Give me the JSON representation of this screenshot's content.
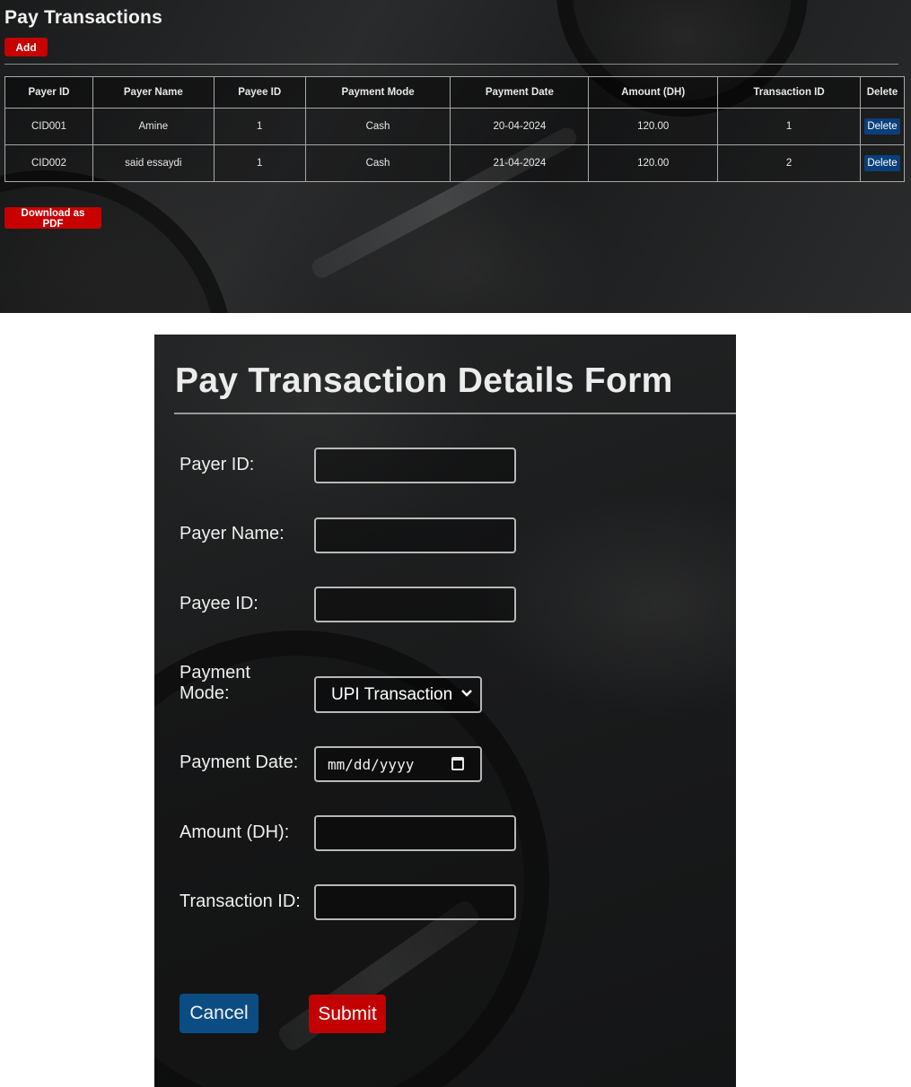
{
  "transactions_page": {
    "title": "Pay Transactions",
    "add_label": "Add",
    "download_label": "Download as PDF",
    "columns": [
      "Payer ID",
      "Payer Name",
      "Payee ID",
      "Payment Mode",
      "Payment Date",
      "Amount (DH)",
      "Transaction ID",
      "Delete"
    ],
    "rows": [
      {
        "payer_id": "CID001",
        "payer_name": "Amine",
        "payee_id": "1",
        "payment_mode": "Cash",
        "payment_date": "20-04-2024",
        "amount": "120.00",
        "transaction_id": "1",
        "delete_label": "Delete"
      },
      {
        "payer_id": "CID002",
        "payer_name": "said essaydi",
        "payee_id": "1",
        "payment_mode": "Cash",
        "payment_date": "21-04-2024",
        "amount": "120.00",
        "transaction_id": "2",
        "delete_label": "Delete"
      }
    ]
  },
  "form": {
    "title": "Pay Transaction Details Form",
    "fields": {
      "payer_id": {
        "label": "Payer ID:",
        "value": ""
      },
      "payer_name": {
        "label": "Payer Name:",
        "value": ""
      },
      "payee_id": {
        "label": "Payee ID:",
        "value": ""
      },
      "payment_mode": {
        "label": "Payment Mode:",
        "selected": "UPI Transaction"
      },
      "payment_date": {
        "label": "Payment Date:",
        "placeholder": "mm/dd/yyyy"
      },
      "amount": {
        "label": "Amount (DH):",
        "value": ""
      },
      "transaction_id": {
        "label": "Transaction ID:",
        "value": ""
      }
    },
    "cancel_label": "Cancel",
    "submit_label": "Submit"
  },
  "icons": {
    "select_chevron": "chevron-down-icon",
    "date_picker": "calendar-icon"
  },
  "colors": {
    "primary_red": "#c70000",
    "delete_blue": "#0a3f7a",
    "cancel_blue": "#0b4d83"
  }
}
